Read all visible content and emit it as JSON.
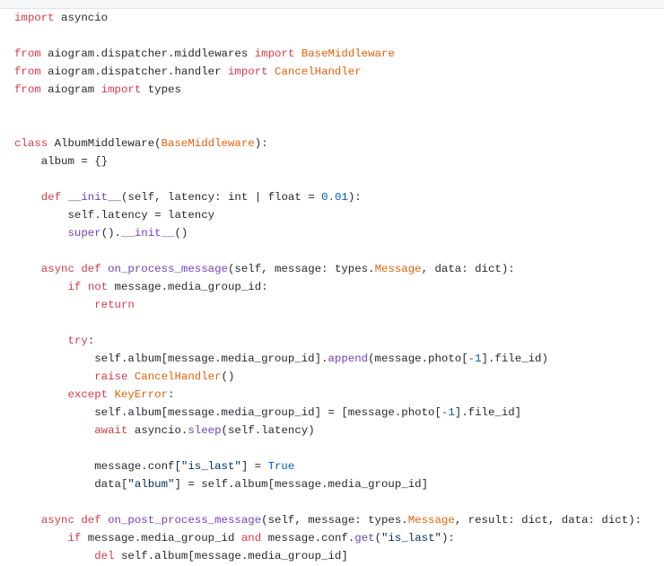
{
  "code": {
    "language": "python",
    "colors": {
      "keyword": "#d73a49",
      "function": "#6f42c1",
      "class_name": "#e36209",
      "string": "#032f62",
      "number": "#005cc5",
      "text": "#24292e"
    },
    "lines": [
      [
        {
          "t": "import",
          "c": "kw"
        },
        {
          "t": " asyncio",
          "c": "txt"
        }
      ],
      [],
      [
        {
          "t": "from",
          "c": "kw"
        },
        {
          "t": " aiogram.dispatcher.middlewares ",
          "c": "txt"
        },
        {
          "t": "import",
          "c": "kw"
        },
        {
          "t": " ",
          "c": "txt"
        },
        {
          "t": "BaseMiddleware",
          "c": "cls"
        }
      ],
      [
        {
          "t": "from",
          "c": "kw"
        },
        {
          "t": " aiogram.dispatcher.handler ",
          "c": "txt"
        },
        {
          "t": "import",
          "c": "kw"
        },
        {
          "t": " ",
          "c": "txt"
        },
        {
          "t": "CancelHandler",
          "c": "cls"
        }
      ],
      [
        {
          "t": "from",
          "c": "kw"
        },
        {
          "t": " aiogram ",
          "c": "txt"
        },
        {
          "t": "import",
          "c": "kw"
        },
        {
          "t": " types",
          "c": "txt"
        }
      ],
      [],
      [],
      [
        {
          "t": "class",
          "c": "kw"
        },
        {
          "t": " AlbumMiddleware(",
          "c": "txt"
        },
        {
          "t": "BaseMiddleware",
          "c": "cls"
        },
        {
          "t": "):",
          "c": "txt"
        }
      ],
      [
        {
          "t": "    album = {}",
          "c": "txt"
        }
      ],
      [],
      [
        {
          "t": "    ",
          "c": "txt"
        },
        {
          "t": "def",
          "c": "kw"
        },
        {
          "t": " ",
          "c": "txt"
        },
        {
          "t": "__init__",
          "c": "fn"
        },
        {
          "t": "(self, latency: int | float = ",
          "c": "txt"
        },
        {
          "t": "0.01",
          "c": "num"
        },
        {
          "t": "):",
          "c": "txt"
        }
      ],
      [
        {
          "t": "        self.latency = latency",
          "c": "txt"
        }
      ],
      [
        {
          "t": "        ",
          "c": "txt"
        },
        {
          "t": "super",
          "c": "fn"
        },
        {
          "t": "().",
          "c": "txt"
        },
        {
          "t": "__init__",
          "c": "fn"
        },
        {
          "t": "()",
          "c": "txt"
        }
      ],
      [],
      [
        {
          "t": "    ",
          "c": "txt"
        },
        {
          "t": "async",
          "c": "kw"
        },
        {
          "t": " ",
          "c": "txt"
        },
        {
          "t": "def",
          "c": "kw"
        },
        {
          "t": " ",
          "c": "txt"
        },
        {
          "t": "on_process_message",
          "c": "fn"
        },
        {
          "t": "(self, message: types.",
          "c": "txt"
        },
        {
          "t": "Message",
          "c": "cls"
        },
        {
          "t": ", data: dict):",
          "c": "txt"
        }
      ],
      [
        {
          "t": "        ",
          "c": "txt"
        },
        {
          "t": "if",
          "c": "kw"
        },
        {
          "t": " ",
          "c": "txt"
        },
        {
          "t": "not",
          "c": "kw"
        },
        {
          "t": " message.media_group_id:",
          "c": "txt"
        }
      ],
      [
        {
          "t": "            ",
          "c": "txt"
        },
        {
          "t": "return",
          "c": "kw"
        }
      ],
      [],
      [
        {
          "t": "        ",
          "c": "txt"
        },
        {
          "t": "try",
          "c": "kw"
        },
        {
          "t": ":",
          "c": "txt"
        }
      ],
      [
        {
          "t": "            self.album[message.media_group_id].",
          "c": "txt"
        },
        {
          "t": "append",
          "c": "fn"
        },
        {
          "t": "(message.photo[",
          "c": "txt"
        },
        {
          "t": "-1",
          "c": "num"
        },
        {
          "t": "].file_id)",
          "c": "txt"
        }
      ],
      [
        {
          "t": "            ",
          "c": "txt"
        },
        {
          "t": "raise",
          "c": "kw"
        },
        {
          "t": " ",
          "c": "txt"
        },
        {
          "t": "CancelHandler",
          "c": "cls"
        },
        {
          "t": "()",
          "c": "txt"
        }
      ],
      [
        {
          "t": "        ",
          "c": "txt"
        },
        {
          "t": "except",
          "c": "kw"
        },
        {
          "t": " ",
          "c": "txt"
        },
        {
          "t": "KeyError",
          "c": "cls"
        },
        {
          "t": ":",
          "c": "txt"
        }
      ],
      [
        {
          "t": "            self.album[message.media_group_id] = [message.photo[",
          "c": "txt"
        },
        {
          "t": "-1",
          "c": "num"
        },
        {
          "t": "].file_id]",
          "c": "txt"
        }
      ],
      [
        {
          "t": "            ",
          "c": "txt"
        },
        {
          "t": "await",
          "c": "kw"
        },
        {
          "t": " asyncio.",
          "c": "txt"
        },
        {
          "t": "sleep",
          "c": "fn"
        },
        {
          "t": "(self.latency)",
          "c": "txt"
        }
      ],
      [],
      [
        {
          "t": "            message.conf[",
          "c": "txt"
        },
        {
          "t": "\"is_last\"",
          "c": "str"
        },
        {
          "t": "] = ",
          "c": "txt"
        },
        {
          "t": "True",
          "c": "num"
        }
      ],
      [
        {
          "t": "            data[",
          "c": "txt"
        },
        {
          "t": "\"album\"",
          "c": "str"
        },
        {
          "t": "] = self.album[message.media_group_id]",
          "c": "txt"
        }
      ],
      [],
      [
        {
          "t": "    ",
          "c": "txt"
        },
        {
          "t": "async",
          "c": "kw"
        },
        {
          "t": " ",
          "c": "txt"
        },
        {
          "t": "def",
          "c": "kw"
        },
        {
          "t": " ",
          "c": "txt"
        },
        {
          "t": "on_post_process_message",
          "c": "fn"
        },
        {
          "t": "(self, message: types.",
          "c": "txt"
        },
        {
          "t": "Message",
          "c": "cls"
        },
        {
          "t": ", result: dict, data: dict):",
          "c": "txt"
        }
      ],
      [
        {
          "t": "        ",
          "c": "txt"
        },
        {
          "t": "if",
          "c": "kw"
        },
        {
          "t": " message.media_group_id ",
          "c": "txt"
        },
        {
          "t": "and",
          "c": "kw"
        },
        {
          "t": " message.conf.",
          "c": "txt"
        },
        {
          "t": "get",
          "c": "fn"
        },
        {
          "t": "(",
          "c": "txt"
        },
        {
          "t": "\"is_last\"",
          "c": "str"
        },
        {
          "t": "):",
          "c": "txt"
        }
      ],
      [
        {
          "t": "            ",
          "c": "txt"
        },
        {
          "t": "del",
          "c": "kw"
        },
        {
          "t": " self.album[message.media_group_id]",
          "c": "txt"
        }
      ]
    ]
  }
}
